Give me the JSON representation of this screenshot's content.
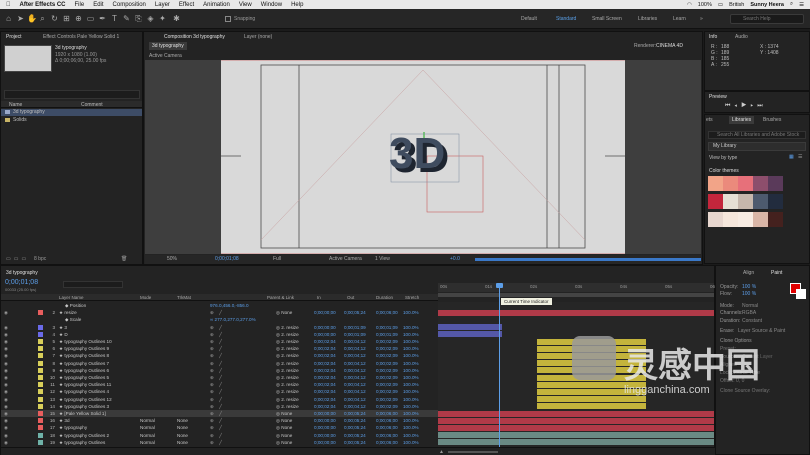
{
  "menubar": {
    "app": "After Effects CC",
    "items": [
      "File",
      "Edit",
      "Composition",
      "Layer",
      "Effect",
      "Animation",
      "View",
      "Window",
      "Help"
    ],
    "status": {
      "battery": "100%",
      "flag": "British",
      "user": "Sunny Heera"
    }
  },
  "workspaces": {
    "items": [
      "Default",
      "Standard",
      "Small Screen",
      "Libraries",
      "Learn"
    ],
    "active": "Standard",
    "search_placeholder": "Search Help",
    "snapping": "Snapping"
  },
  "project": {
    "tab": "Project",
    "effect_tab": "Effect Controls Pale Yellow Solid 1",
    "item_name": "3d typography",
    "item_line1": "1920 x 1080 (1.00)",
    "item_line2": "Δ 0;00;06;00, 25.00 fps",
    "col_name": "Name",
    "col_comment": "Comment",
    "items": [
      "3d typography",
      "Solids"
    ],
    "bpc": "8 bpc"
  },
  "comp": {
    "tab": "Composition 3d typography",
    "layer_tab": "Layer (none)",
    "subtab": "3d typography",
    "renderer_label": "Renderer:",
    "renderer": "CINEMA 4D",
    "camera": "Active Camera",
    "zoom": "50%",
    "time": "0;00;01;08",
    "res": "Full",
    "view_cam": "Active Camera",
    "views": "1 View",
    "exposure": "+0.0"
  },
  "info": {
    "tab1": "Info",
    "tab2": "Audio",
    "r": "R :",
    "g": "G :",
    "b": "B :",
    "a": "A :",
    "rv": "188",
    "gv": "189",
    "bv": "185",
    "av": "255",
    "x": "X : 1374",
    "y": "Y : 1408"
  },
  "preview": {
    "title": "Preview"
  },
  "libraries": {
    "tab0": "ets",
    "tab1": "Libraries",
    "tab2": "Brushes",
    "search": "Search All Libraries and Adobe Stock",
    "lib": "My Library",
    "view": "View by type",
    "section": "Color themes",
    "themes": [
      [
        "#f2a488",
        "#eb8a7c",
        "#e7707a",
        "#8d4e6c",
        "#5a3a5a"
      ],
      [
        "#c4263c",
        "#e6dfd4",
        "#c6b7ac",
        "#4d5a6e",
        "#222c3e"
      ],
      [
        "#e8d7cf",
        "#f6e7dc",
        "#f8ece3",
        "#d9b5a6",
        "#44211e"
      ]
    ]
  },
  "timeline": {
    "tab": "3d typography",
    "timecode": "0;00;01;08",
    "subcode": "00033 (25.00 fps)",
    "tooltip": "Current Time Indicator",
    "ruler": [
      "00s",
      "01s",
      "02s",
      "03s",
      "04s",
      "05s",
      "06s"
    ],
    "headers": {
      "name": "Layer Name",
      "mode": "Mode",
      "track": "TrkMat",
      "parent": "Parent & Link",
      "in": "In",
      "out": "Out",
      "dur": "Duration",
      "str": "Stretch"
    },
    "rows": [
      {
        "num": "",
        "name": "Position",
        "mode": "",
        "track": "",
        "parent": "",
        "in": "",
        "out": "",
        "dur": "",
        "str": "",
        "color": "",
        "sub": "",
        "val": "976.0,456.0,-856.0"
      },
      {
        "num": "2",
        "name": "resize",
        "mode": "",
        "track": "",
        "parent": "None",
        "in": "0;00;00;00",
        "out": "0;00;05;24",
        "dur": "0;00;06;00",
        "str": "100.0%",
        "color": "#e85e5e",
        "sub": "",
        "val": ""
      },
      {
        "num": "",
        "name": "Scale",
        "mode": "",
        "track": "",
        "parent": "",
        "in": "",
        "out": "",
        "dur": "",
        "str": "",
        "color": "",
        "sub": "",
        "val": "∞ 277.0,277.0,277.0%"
      },
      {
        "num": "3",
        "name": "3",
        "mode": "",
        "track": "",
        "parent": "2. resize",
        "in": "0;00;00;00",
        "out": "0;00;01;09",
        "dur": "0;00;01;09",
        "str": "100.0%",
        "color": "#6a6ae8",
        "sub": "",
        "val": ""
      },
      {
        "num": "4",
        "name": "D",
        "mode": "",
        "track": "",
        "parent": "2. resize",
        "in": "0;00;00;00",
        "out": "0;00;01;09",
        "dur": "0;00;01;09",
        "str": "100.0%",
        "color": "#6a6ae8",
        "sub": "",
        "val": ""
      },
      {
        "num": "5",
        "name": "typography Outlines 10",
        "mode": "",
        "track": "",
        "parent": "2. resize",
        "in": "0;00;02;04",
        "out": "0;00;04;12",
        "dur": "0;00;02;09",
        "str": "100.0%",
        "color": "#d8cf5a",
        "sub": "",
        "val": ""
      },
      {
        "num": "6",
        "name": "typography Outlines 9",
        "mode": "",
        "track": "",
        "parent": "2. resize",
        "in": "0;00;02;04",
        "out": "0;00;04;12",
        "dur": "0;00;02;09",
        "str": "100.0%",
        "color": "#d8cf5a",
        "sub": "",
        "val": ""
      },
      {
        "num": "7",
        "name": "typography Outlines 8",
        "mode": "",
        "track": "",
        "parent": "2. resize",
        "in": "0;00;02;04",
        "out": "0;00;04;12",
        "dur": "0;00;02;09",
        "str": "100.0%",
        "color": "#d8cf5a",
        "sub": "",
        "val": ""
      },
      {
        "num": "8",
        "name": "typography Outlines 7",
        "mode": "",
        "track": "",
        "parent": "2. resize",
        "in": "0;00;02;04",
        "out": "0;00;04;12",
        "dur": "0;00;02;09",
        "str": "100.0%",
        "color": "#d8cf5a",
        "sub": "",
        "val": ""
      },
      {
        "num": "9",
        "name": "typography Outlines 6",
        "mode": "",
        "track": "",
        "parent": "2. resize",
        "in": "0;00;02;04",
        "out": "0;00;04;12",
        "dur": "0;00;02;09",
        "str": "100.0%",
        "color": "#d8cf5a",
        "sub": "",
        "val": ""
      },
      {
        "num": "10",
        "name": "typography Outlines 5",
        "mode": "",
        "track": "",
        "parent": "2. resize",
        "in": "0;00;02;04",
        "out": "0;00;04;12",
        "dur": "0;00;02;09",
        "str": "100.0%",
        "color": "#d8cf5a",
        "sub": "",
        "val": ""
      },
      {
        "num": "11",
        "name": "typography Outlines 11",
        "mode": "",
        "track": "",
        "parent": "2. resize",
        "in": "0;00;02;04",
        "out": "0;00;04;12",
        "dur": "0;00;02;09",
        "str": "100.0%",
        "color": "#d8cf5a",
        "sub": "",
        "val": ""
      },
      {
        "num": "12",
        "name": "typography Outlines 4",
        "mode": "",
        "track": "",
        "parent": "2. resize",
        "in": "0;00;02;04",
        "out": "0;00;04;12",
        "dur": "0;00;02;09",
        "str": "100.0%",
        "color": "#d8cf5a",
        "sub": "",
        "val": ""
      },
      {
        "num": "13",
        "name": "typography Outlines 12",
        "mode": "",
        "track": "",
        "parent": "2. resize",
        "in": "0;00;02;04",
        "out": "0;00;04;12",
        "dur": "0;00;02;09",
        "str": "100.0%",
        "color": "#d8cf5a",
        "sub": "",
        "val": ""
      },
      {
        "num": "14",
        "name": "typography Outlines 3",
        "mode": "",
        "track": "",
        "parent": "2. resize",
        "in": "0;00;02;04",
        "out": "0;00;04;12",
        "dur": "0;00;02;09",
        "str": "100.0%",
        "color": "#d8cf5a",
        "sub": "",
        "val": ""
      },
      {
        "num": "15",
        "name": "[Pale Yellow Solid 1]",
        "mode": "",
        "track": "",
        "parent": "None",
        "in": "0;00;00;00",
        "out": "0;00;05;24",
        "dur": "0;00;06;00",
        "str": "100.0%",
        "color": "#e85e5e",
        "sub": "",
        "val": ""
      },
      {
        "num": "16",
        "name": "3d",
        "mode": "Normal",
        "track": "None",
        "parent": "None",
        "in": "0;00;00;00",
        "out": "0;00;05;24",
        "dur": "0;00;06;00",
        "str": "100.0%",
        "color": "#e85e5e",
        "sub": "",
        "val": ""
      },
      {
        "num": "17",
        "name": "typography",
        "mode": "Normal",
        "track": "None",
        "parent": "None",
        "in": "0;00;00;00",
        "out": "0;00;05;24",
        "dur": "0;00;06;00",
        "str": "100.0%",
        "color": "#e85e5e",
        "sub": "",
        "val": ""
      },
      {
        "num": "18",
        "name": "typography Outlines 2",
        "mode": "Normal",
        "track": "None",
        "parent": "None",
        "in": "0;00;00;00",
        "out": "0;00;05;24",
        "dur": "0;00;06;00",
        "str": "100.0%",
        "color": "#6fb2a8",
        "sub": "",
        "val": ""
      },
      {
        "num": "19",
        "name": "typography Outlines",
        "mode": "Normal",
        "track": "None",
        "parent": "None",
        "in": "0;00;00;00",
        "out": "0;00;05;24",
        "dur": "0;00;06;00",
        "str": "100.0%",
        "color": "#6fb2a8",
        "sub": "",
        "val": ""
      }
    ]
  },
  "properties": {
    "tab1": "Align",
    "tab2": "Paint",
    "opacity_label": "Opacity:",
    "opacity": "100 %",
    "flow_label": "Flow:",
    "flow": "100 %",
    "mode_label": "Mode:",
    "mode": "Normal",
    "channels_label": "Channels:",
    "channels": "RGBA",
    "duration_label": "Duration:",
    "duration": "Constant",
    "erase_label": "Erase:",
    "erase": "Layer Source & Paint",
    "clone_label": "Clone Options",
    "preset_label": "Preset:",
    "source_label": "Source:",
    "source": "Current Layer",
    "aligned": "Aligned",
    "lock": "Lock Source Time",
    "offset": "Offset: 0, 0",
    "shift": "Clone Source Overlay:"
  },
  "watermark": {
    "text": "灵感中国",
    "url": "lingganchina.com"
  },
  "colors": {
    "accent": "#5aa0e8",
    "canvas": "#d9d9d9",
    "text3d": "#2f3a4a"
  }
}
